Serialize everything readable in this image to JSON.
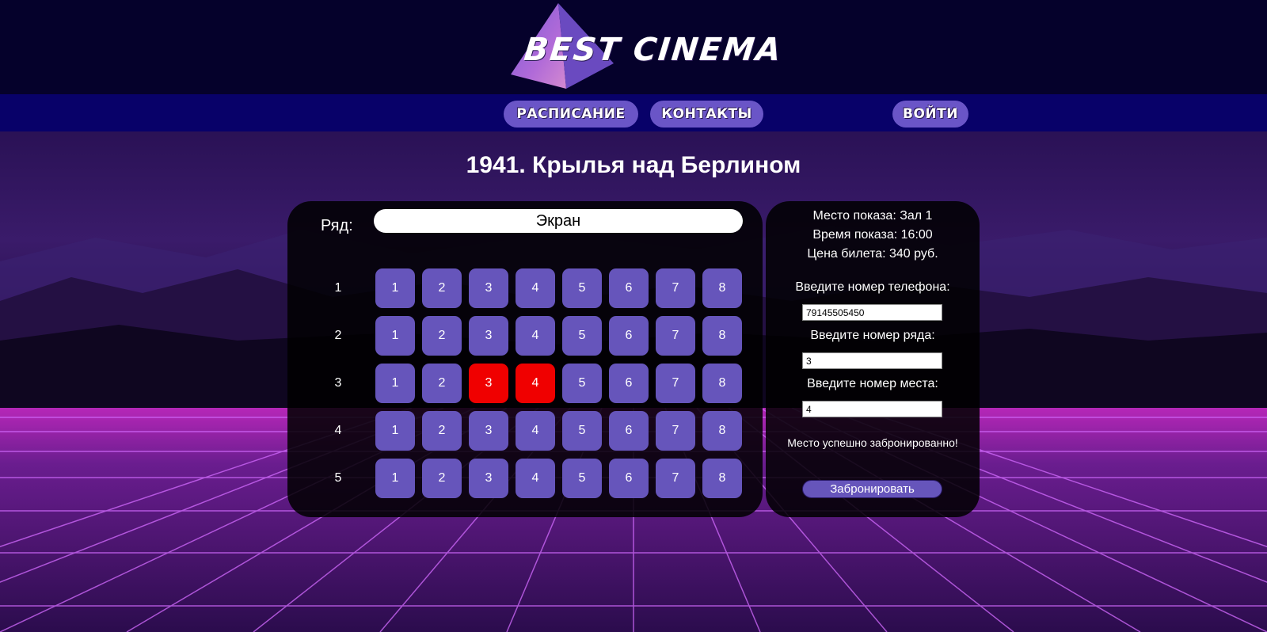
{
  "logo": {
    "text": "BEST CINEMA"
  },
  "nav": {
    "schedule": "РАСПИСАНИЕ",
    "contacts": "КОНТАКТЫ",
    "login": "ВОЙТИ"
  },
  "movie": {
    "title": "1941. Крылья над Берлином"
  },
  "hall": {
    "row_label": "Ряд:",
    "screen_label": "Экран",
    "rows": [
      {
        "number": "1",
        "seats": [
          "1",
          "2",
          "3",
          "4",
          "5",
          "6",
          "7",
          "8"
        ],
        "booked": []
      },
      {
        "number": "2",
        "seats": [
          "1",
          "2",
          "3",
          "4",
          "5",
          "6",
          "7",
          "8"
        ],
        "booked": []
      },
      {
        "number": "3",
        "seats": [
          "1",
          "2",
          "3",
          "4",
          "5",
          "6",
          "7",
          "8"
        ],
        "booked": [
          "3",
          "4"
        ]
      },
      {
        "number": "4",
        "seats": [
          "1",
          "2",
          "3",
          "4",
          "5",
          "6",
          "7",
          "8"
        ],
        "booked": []
      },
      {
        "number": "5",
        "seats": [
          "1",
          "2",
          "3",
          "4",
          "5",
          "6",
          "7",
          "8"
        ],
        "booked": []
      }
    ]
  },
  "info": {
    "venue": "Место показа: Зал 1",
    "time": "Время показа: 16:00",
    "price": "Цена билета: 340 руб."
  },
  "form": {
    "phone_label": "Введите номер телефона:",
    "phone_value": "79145505450",
    "row_label": "Введите номер ряда:",
    "row_value": "3",
    "seat_label": "Введите номер места:",
    "seat_value": "4",
    "success_message": "Место успешно забронированно!",
    "submit_label": "Забронировать"
  },
  "colors": {
    "header_bg": "#05012b",
    "nav_bg": "#080169",
    "accent": "#6655bb",
    "booked": "#f00000"
  }
}
